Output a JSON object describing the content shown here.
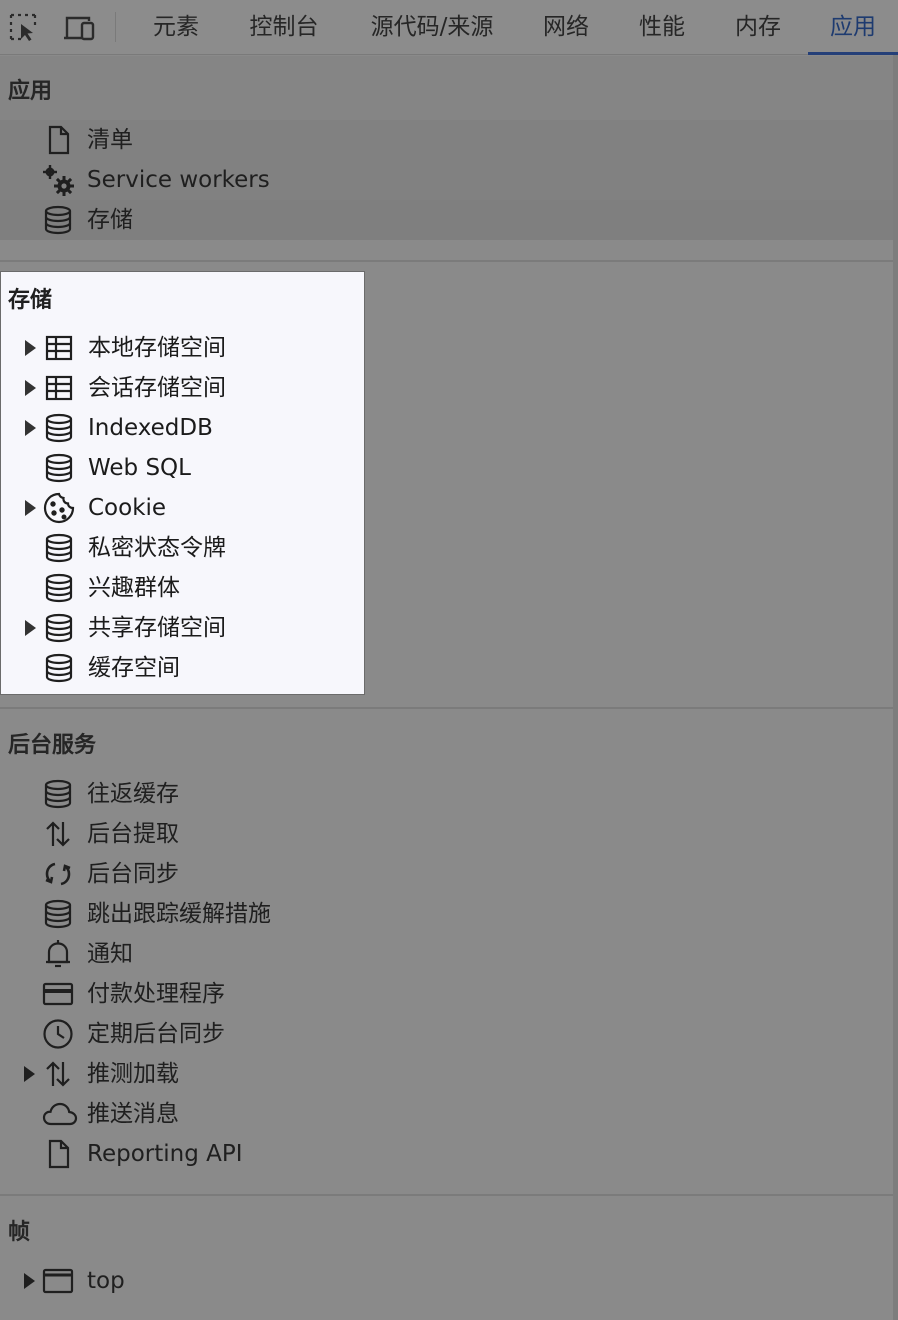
{
  "toolbar": {
    "tabs": [
      "元素",
      "控制台",
      "源代码/来源",
      "网络",
      "性能",
      "内存",
      "应用"
    ],
    "active_tab": "应用",
    "icons": [
      "inspect-element-icon",
      "device-toggle-icon"
    ]
  },
  "sections": {
    "app": {
      "title": "应用",
      "items": [
        {
          "label": "清单",
          "icon": "document-icon",
          "expandable": false
        },
        {
          "label": "Service workers",
          "icon": "gears-icon",
          "expandable": false
        },
        {
          "label": "存储",
          "icon": "database-icon",
          "expandable": false,
          "selected": true
        }
      ]
    },
    "storage": {
      "title": "存储",
      "items": [
        {
          "label": "本地存储空间",
          "icon": "table-icon",
          "expandable": true
        },
        {
          "label": "会话存储空间",
          "icon": "table-icon",
          "expandable": true
        },
        {
          "label": "IndexedDB",
          "icon": "database-icon",
          "expandable": true
        },
        {
          "label": "Web SQL",
          "icon": "database-icon",
          "expandable": false
        },
        {
          "label": "Cookie",
          "icon": "cookie-icon",
          "expandable": true
        },
        {
          "label": "私密状态令牌",
          "icon": "database-icon",
          "expandable": false
        },
        {
          "label": "兴趣群体",
          "icon": "database-icon",
          "expandable": false
        },
        {
          "label": "共享存储空间",
          "icon": "database-icon",
          "expandable": true
        },
        {
          "label": "缓存空间",
          "icon": "database-icon",
          "expandable": false
        }
      ]
    },
    "background": {
      "title": "后台服务",
      "items": [
        {
          "label": "往返缓存",
          "icon": "database-icon",
          "expandable": false
        },
        {
          "label": "后台提取",
          "icon": "up-down-arrows-icon",
          "expandable": false
        },
        {
          "label": "后台同步",
          "icon": "sync-icon",
          "expandable": false
        },
        {
          "label": "跳出跟踪缓解措施",
          "icon": "database-icon",
          "expandable": false
        },
        {
          "label": "通知",
          "icon": "bell-icon",
          "expandable": false
        },
        {
          "label": "付款处理程序",
          "icon": "credit-card-icon",
          "expandable": false
        },
        {
          "label": "定期后台同步",
          "icon": "clock-icon",
          "expandable": false
        },
        {
          "label": "推测加载",
          "icon": "up-down-arrows-icon",
          "expandable": true
        },
        {
          "label": "推送消息",
          "icon": "cloud-icon",
          "expandable": false
        },
        {
          "label": "Reporting API",
          "icon": "document-icon",
          "expandable": false
        }
      ]
    },
    "frames": {
      "title": "帧",
      "items": [
        {
          "label": "top",
          "icon": "frame-window-icon",
          "expandable": true
        }
      ]
    }
  }
}
